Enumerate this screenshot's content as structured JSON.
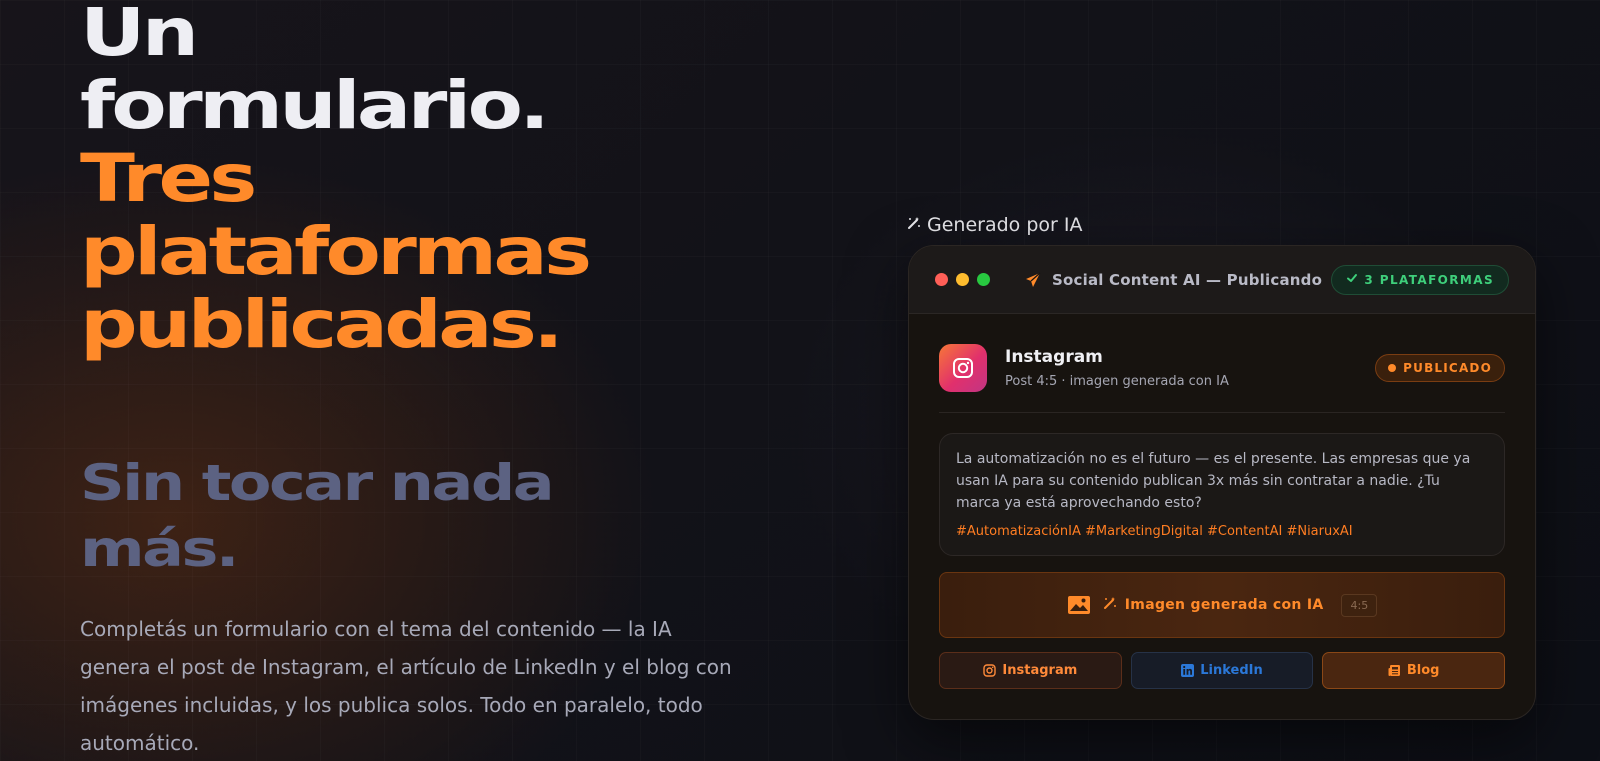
{
  "hero": {
    "title_line1": "Un",
    "title_line2": "formulario.",
    "title_line3": "Tres",
    "title_line4": "plataformas",
    "title_line5": "publicadas.",
    "subtitle_line1": "Sin tocar nada",
    "subtitle_line2": "más.",
    "description": "Completás un formulario con el tema del contenido — la IA genera el post de Instagram, el artículo de LinkedIn y el blog con imágenes incluidas, y los publica solos. Todo en paralelo, todo automático."
  },
  "ai_tag": {
    "label": "Generado por IA",
    "icon": "magic-wand-icon"
  },
  "card": {
    "title": "Social Content AI — Publicando",
    "platforms_badge": "3 PLATAFORMAS",
    "instagram": {
      "name": "Instagram",
      "meta": "Post 4:5 · imagen generada con IA",
      "status": "PUBLICADO"
    },
    "post": {
      "text": "La automatización no es el futuro — es el presente. Las empresas que ya usan IA para su contenido publican 3x más sin contratar a nadie. ¿Tu marca ya está aprovechando esto?",
      "hashtags": "#AutomatizaciónIA #MarketingDigital #ContentAI #NiaruxAI"
    },
    "image": {
      "label": "Imagen generada con IA",
      "ratio": "4:5"
    },
    "platforms": [
      {
        "label": "Instagram",
        "icon": "instagram-icon"
      },
      {
        "label": "LinkedIn",
        "icon": "linkedin-icon"
      },
      {
        "label": "Blog",
        "icon": "newspaper-icon"
      }
    ]
  },
  "colors": {
    "accent_orange": "#ff8a2a",
    "subtitle_slate": "#5c6282",
    "success_green": "#3ecf7b",
    "linkedin_blue": "#2b78d8"
  }
}
